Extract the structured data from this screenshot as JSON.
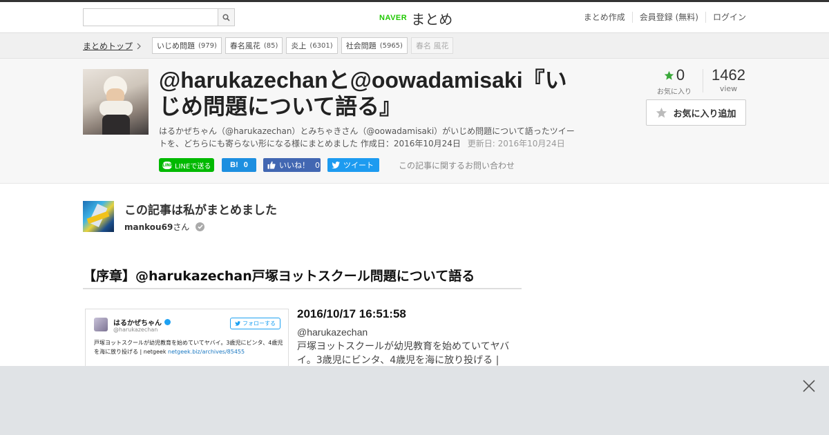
{
  "header": {
    "search": {
      "value": "",
      "placeholder": ""
    },
    "logo": {
      "naver": "NAVER",
      "matome": "まとめ"
    },
    "links": [
      "まとめ作成",
      "会員登録 (無料)",
      "ログイン"
    ]
  },
  "tagbar": {
    "top_link": "まとめトップ",
    "tags": [
      {
        "label": "いじめ問題",
        "count": "(979)"
      },
      {
        "label": "春名風花",
        "count": "(85)"
      },
      {
        "label": "炎上",
        "count": "(6301)"
      },
      {
        "label": "社会問題",
        "count": "(5965)"
      },
      {
        "label": "春名 風花",
        "count": ""
      }
    ]
  },
  "article": {
    "title": "@harukazechanと@oowadamisaki『いじめ問題について語る』",
    "description": "はるかぜちゃん（@harukazechan）とみちゃきさん（@oowadamisaki）がいじめ問題について語ったツイートを、どちらにも寄らない形になる様にまとめました",
    "created": "作成日：2016年10月24日",
    "updated": "更新日: 2016年10月24日",
    "share": {
      "line": "LINEで送る",
      "hatena_count": "0",
      "fb_label": "いいね！",
      "fb_count": "0",
      "tweet": "ツイート",
      "inquiry": "この記事に関するお問い合わせ"
    },
    "favorites": {
      "count": "0",
      "label": "お気に入り"
    },
    "views": {
      "count": "1462",
      "label": "view"
    },
    "fav_button": "お気に入り追加"
  },
  "author": {
    "heading": "この記事は私がまとめました",
    "name": "mankou69",
    "suffix": "さん"
  },
  "section": {
    "title": "【序章】@harukazechan戸塚ヨットスクール問題について語る"
  },
  "tweet": {
    "image": {
      "name": "はるかぜちゃん",
      "handle": "@harukazechan",
      "follow": "フォローする",
      "text": "戸塚ヨットスクールが幼児教育を始めていてヤバイ。3歳児にビンタ、4歳児を海に放り投げる | netgeek",
      "link": "netgeek.biz/archives/85455"
    },
    "date": "2016/10/17 16:51:58",
    "user": "@harukazechan",
    "text": "戸塚ヨットスクールが幼児教育を始めていてヤバイ。3歳児にビンタ、4歳児を海に放り投げる |"
  },
  "colors": {
    "naver_green": "#1ec800",
    "line_green": "#00b900",
    "hatena_blue": "#1d8fe0",
    "facebook_blue": "#4267b2",
    "twitter_blue": "#1d9bf0",
    "star_green": "#3aa83a"
  },
  "icons": {
    "search": "search-icon",
    "chevron": "chevron-right-icon",
    "star": "star-icon",
    "verified": "check-circle-icon",
    "close": "close-icon"
  }
}
